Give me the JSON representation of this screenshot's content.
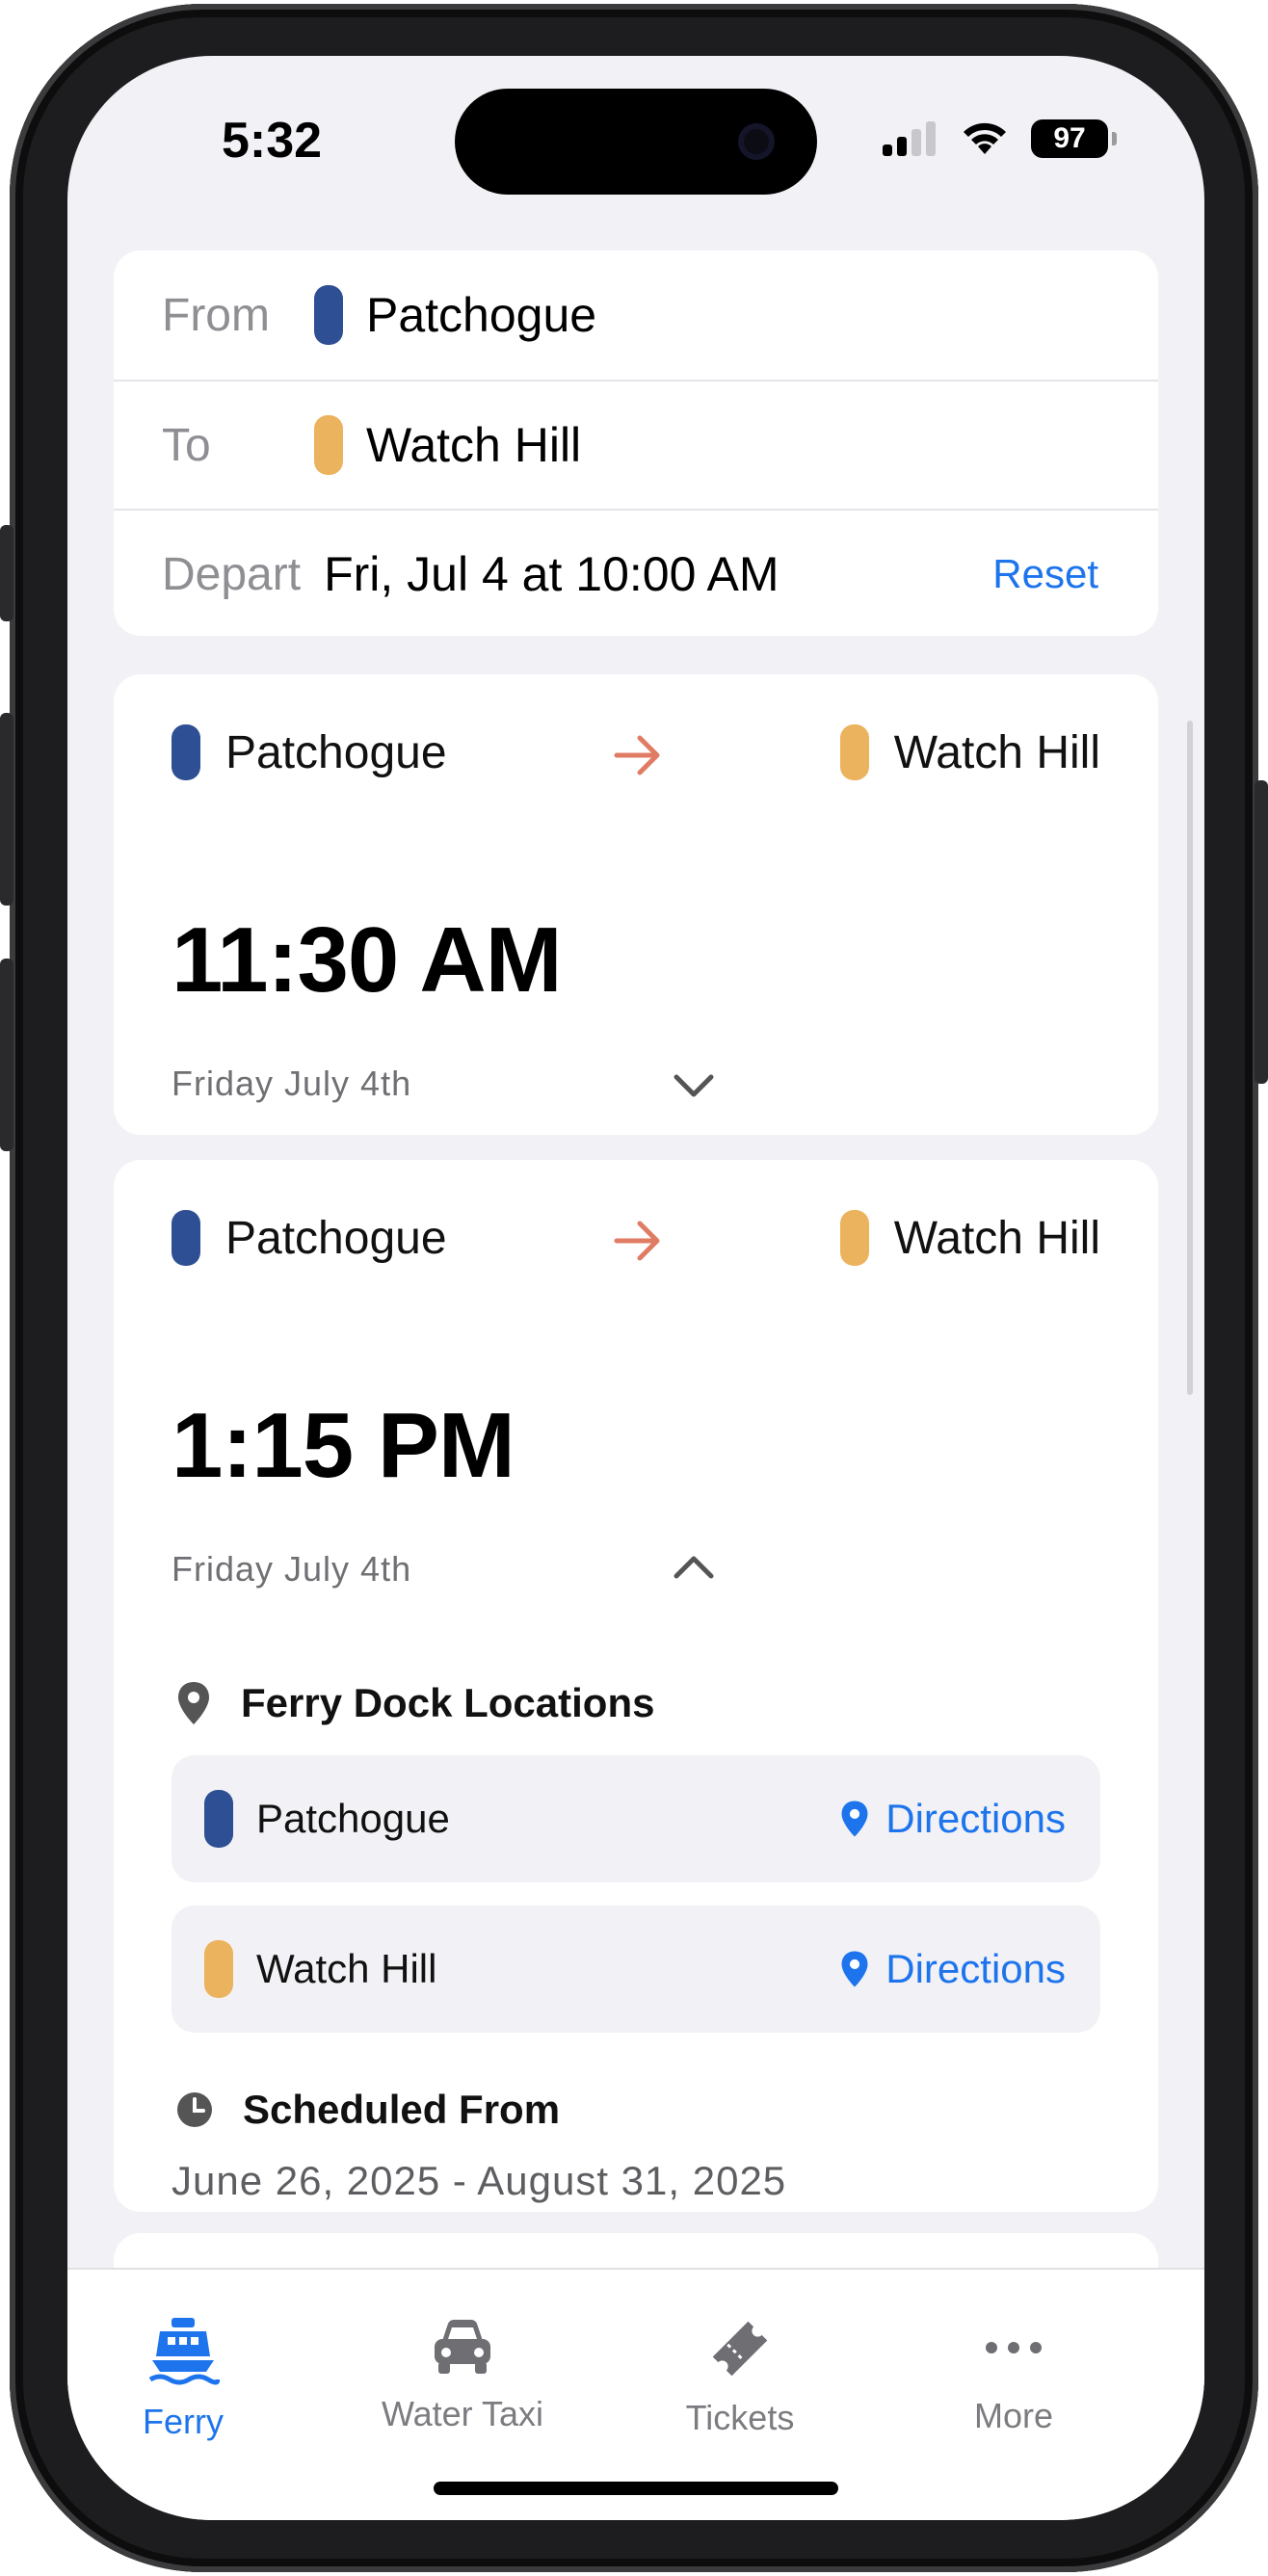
{
  "status": {
    "time": "5:32",
    "battery": "97"
  },
  "colors": {
    "accent": "#1d74ec",
    "patchogue": "#2e4f93",
    "watch_hill": "#ecb35e",
    "arrow": "#e07c64"
  },
  "search": {
    "from_label": "From",
    "from_value": "Patchogue",
    "to_label": "To",
    "to_value": "Watch Hill",
    "depart_label": "Depart",
    "depart_value": "Fri, Jul 4 at 10:00 AM",
    "reset_label": "Reset"
  },
  "trips": [
    {
      "origin": "Patchogue",
      "destination": "Watch Hill",
      "time": "11:30 AM",
      "date": "Friday July 4th",
      "expanded": false
    },
    {
      "origin": "Patchogue",
      "destination": "Watch Hill",
      "time": "1:15 PM",
      "date": "Friday July 4th",
      "expanded": true,
      "docks_title": "Ferry Dock Locations",
      "docks": [
        {
          "name": "Patchogue",
          "action": "Directions"
        },
        {
          "name": "Watch Hill",
          "action": "Directions"
        }
      ],
      "schedule_title": "Scheduled From",
      "schedule_range": "June 26, 2025 - August 31, 2025"
    }
  ],
  "tabs": [
    {
      "label": "Ferry",
      "icon": "ferry-icon",
      "active": true
    },
    {
      "label": "Water Taxi",
      "icon": "car-icon",
      "active": false
    },
    {
      "label": "Tickets",
      "icon": "ticket-icon",
      "active": false
    },
    {
      "label": "More",
      "icon": "ellipsis-icon",
      "active": false
    }
  ]
}
